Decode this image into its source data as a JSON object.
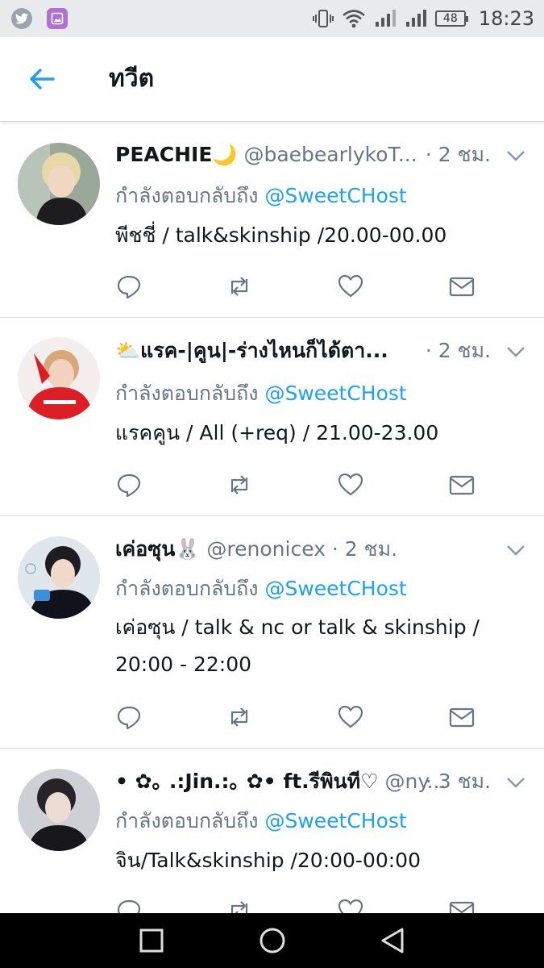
{
  "status_bar": {
    "app_icons": [
      "twitter-icon",
      "gallery-icon"
    ],
    "indicators": [
      "vibrate-icon",
      "wifi-icon",
      "signal-icon",
      "signal-icon"
    ],
    "battery": "48",
    "time": "18:23"
  },
  "header": {
    "title": "ทวีต"
  },
  "colors": {
    "accent": "#1da1f2",
    "secondary_text": "#657786",
    "primary_text": "#14171a"
  },
  "tweets": [
    {
      "name": "PEACHIE🌙",
      "handle": "@baebearlykoT...",
      "time": "· 2 ชม.",
      "reply_prefix": "กำลังตอบกลับถึง",
      "reply_to": "@SweetCHost",
      "text": "พีชชี่ / talk&skinship /20.00-00.00"
    },
    {
      "name": "⛅แรค-|คูน|-ร่างไหนก็ได้ตา...",
      "handle": "",
      "time": "· 2 ชม.",
      "reply_prefix": "กำลังตอบกลับถึง",
      "reply_to": "@SweetCHost",
      "text": "แรคคูน / All (+req) / 21.00-23.00"
    },
    {
      "name": "เค่อซุน🐰",
      "handle": "@renonicex",
      "time": "· 2 ชม.",
      "reply_prefix": "กำลังตอบกลับถึง",
      "reply_to": "@SweetCHost",
      "text": "เค่อซุน / talk & nc or talk & skinship / 20:00 - 22:00"
    },
    {
      "name": "• ✿｡ .:Jin.:｡ ✿• ft.รีพินที♡",
      "handle": "@ny...",
      "time": "· 3 ชม.",
      "reply_prefix": "กำลังตอบกลับถึง",
      "reply_to": "@SweetCHost",
      "text": "จิน/Talk&skinship /20:00-00:00"
    }
  ],
  "nav_bar": {
    "buttons": [
      "recents-icon",
      "home-icon",
      "back-icon"
    ]
  }
}
